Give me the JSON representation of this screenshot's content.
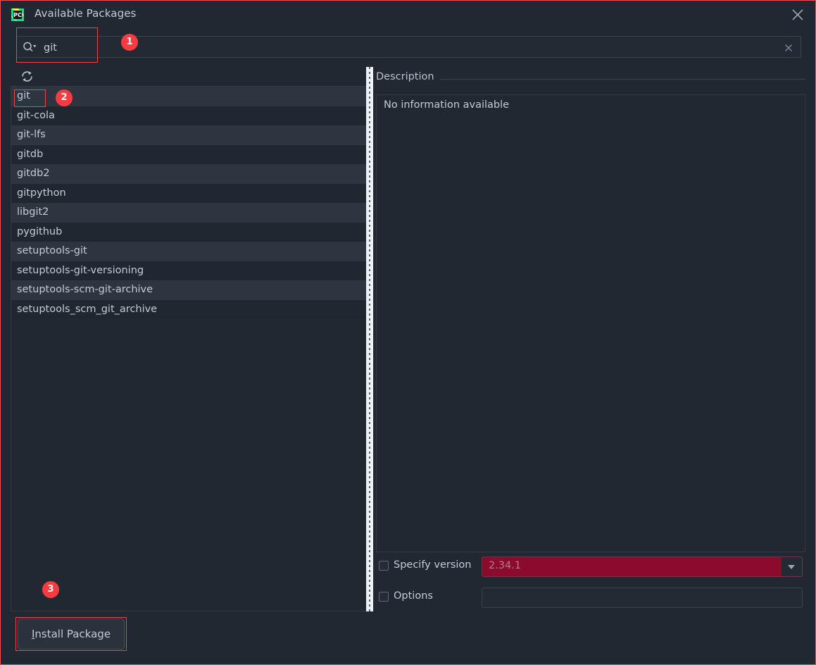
{
  "window": {
    "title": "Available Packages",
    "app_icon": "pycharm-icon",
    "close_icon": "close-icon"
  },
  "search": {
    "icon": "search-icon",
    "value": "git",
    "placeholder": "",
    "clear_icon": "close-icon"
  },
  "toolbar": {
    "refresh_icon": "refresh-icon"
  },
  "packages": {
    "selected": "git",
    "items": [
      "git",
      "git-cola",
      "git-lfs",
      "gitdb",
      "gitdb2",
      "gitpython",
      "libgit2",
      "pygithub",
      "setuptools-git",
      "setuptools-git-versioning",
      "setuptools-scm-git-archive",
      "setuptools_scm_git_archive"
    ]
  },
  "description": {
    "title": "Description",
    "body": "No information available"
  },
  "options": {
    "specify_version_label": "Specify version",
    "specify_version_checked": false,
    "version_value": "2.34.1",
    "version_dropdown_icon": "chevron-down-icon",
    "options_label": "Options",
    "options_checked": false,
    "options_value": "",
    "options_placeholder": ""
  },
  "actions": {
    "install_mnemonic": "I",
    "install_rest": "nstall Package"
  },
  "annotations": [
    {
      "number": "1"
    },
    {
      "number": "2"
    },
    {
      "number": "3"
    }
  ],
  "colors": {
    "dialog_bg": "#222832",
    "row_odd": "#2d3540",
    "row_even": "#212731",
    "text": "#c3ccd6",
    "accent_red": "#f63b41",
    "version_field_bg": "#8c0b2c",
    "splitter": "#eef1f5"
  }
}
